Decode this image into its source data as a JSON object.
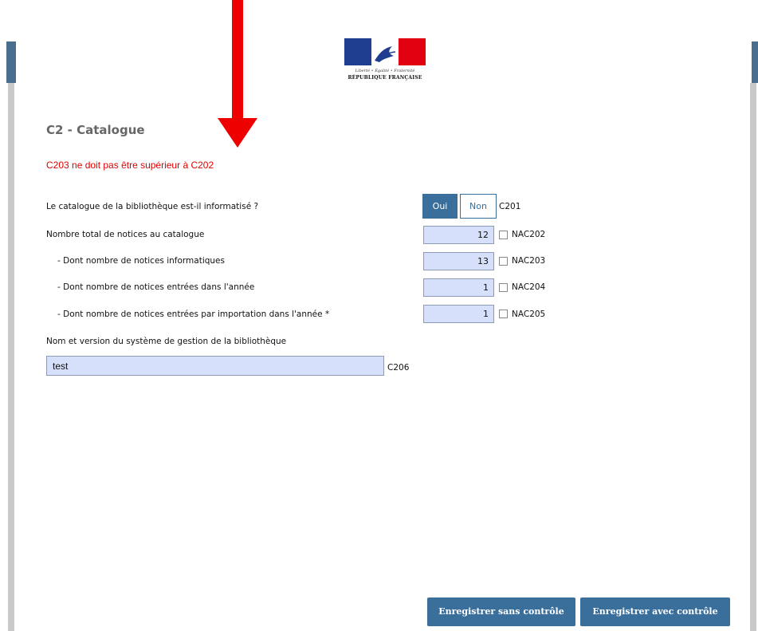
{
  "logo": {
    "motto": "Liberté • Égalité • Fraternité",
    "name": "RÉPUBLIQUE FRANÇAISE"
  },
  "section_title": "C2 - Catalogue",
  "error_message": "C203 ne doit pas être supérieur à C202",
  "questions": {
    "informatise": {
      "label": "Le catalogue de la bibliothèque est-il informatisé ?",
      "yes": "Oui",
      "no": "Non",
      "selected": "Oui",
      "code": "C201"
    },
    "total": {
      "label": "Nombre total de notices au catalogue",
      "value": "12",
      "na": "NA",
      "code": "C202"
    },
    "informatiques": {
      "label": "- Dont nombre de notices informatiques",
      "value": "13",
      "na": "NA",
      "code": "C203"
    },
    "annee": {
      "label": "- Dont nombre de notices entrées dans l'année",
      "value": "1",
      "na": "NA",
      "code": "C204"
    },
    "importation": {
      "label": "- Dont nombre de notices entrées par importation dans l'année *",
      "value": "1",
      "na": "NA",
      "code": "C205"
    },
    "systeme": {
      "label": "Nom et version du système de gestion de la bibliothèque",
      "value": "test",
      "code": "C206"
    }
  },
  "buttons": {
    "save_without": "Enregistrer sans contrôle",
    "save_with": "Enregistrer avec contrôle"
  },
  "colors": {
    "accent": "#3a6f9b",
    "error": "#e30000",
    "input_bg": "#d6e0fb",
    "annotation_arrow": "#ee0000"
  }
}
